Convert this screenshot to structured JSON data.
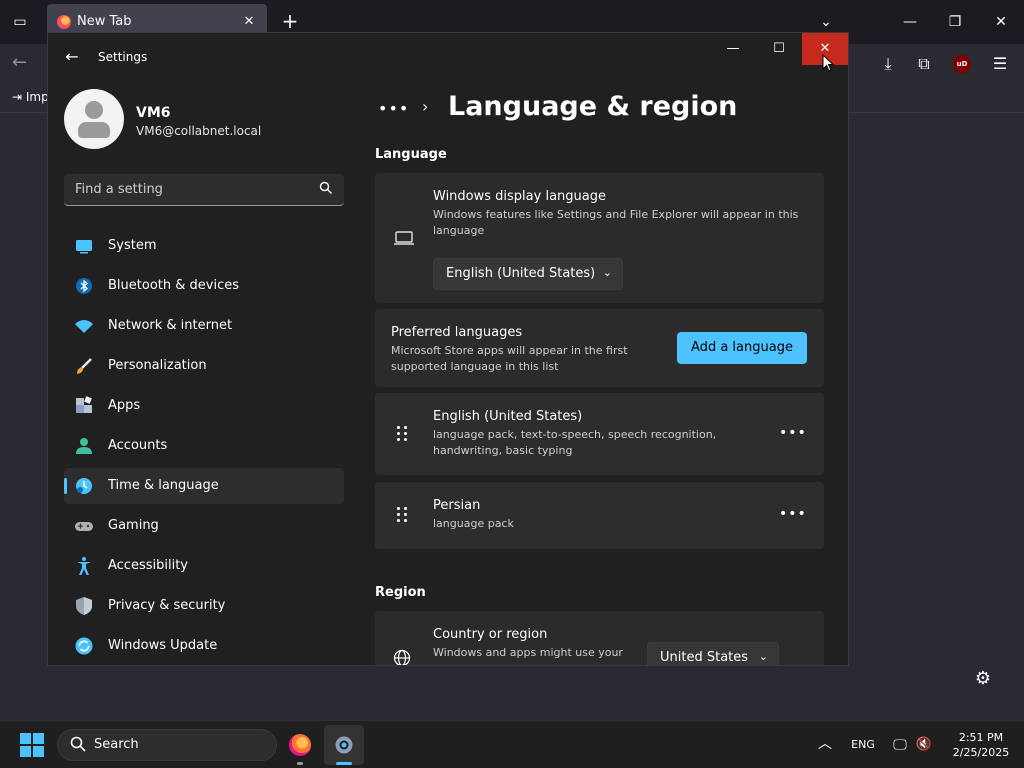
{
  "browser": {
    "tab_title": "New Tab",
    "tab_close": "✕",
    "new_tab": "+",
    "tabs_menu": "⌄",
    "minimize": "—",
    "restore": "❐",
    "close": "✕",
    "import_label": "Imp",
    "ublock_label": "uD"
  },
  "window": {
    "app_title": "Settings",
    "minimize": "—",
    "maximize": "☐",
    "close": "✕"
  },
  "profile": {
    "name": "VM6",
    "email": "VM6@collabnet.local"
  },
  "search": {
    "placeholder": "Find a setting"
  },
  "sidebar": {
    "items": [
      {
        "label": "System",
        "icon": "system-icon",
        "color": "#4cc2ff"
      },
      {
        "label": "Bluetooth & devices",
        "icon": "bluetooth-icon",
        "color": "#0f6cbd"
      },
      {
        "label": "Network & internet",
        "icon": "wifi-icon",
        "color": "#4cc2ff"
      },
      {
        "label": "Personalization",
        "icon": "brush-icon",
        "color": "#e8a33c"
      },
      {
        "label": "Apps",
        "icon": "apps-icon",
        "color": "#8ea2c0"
      },
      {
        "label": "Accounts",
        "icon": "accounts-icon",
        "color": "#3fc1a0"
      },
      {
        "label": "Time & language",
        "icon": "time-language-icon",
        "color": "#4cc2ff"
      },
      {
        "label": "Gaming",
        "icon": "gaming-icon",
        "color": "#b0b0b0"
      },
      {
        "label": "Accessibility",
        "icon": "accessibility-icon",
        "color": "#4cc2ff"
      },
      {
        "label": "Privacy & security",
        "icon": "shield-icon",
        "color": "#9aa4b0"
      },
      {
        "label": "Windows Update",
        "icon": "update-icon",
        "color": "#4cc2ff"
      }
    ],
    "selected_index": 6
  },
  "main": {
    "breadcrumb_more": "•••",
    "breadcrumb_sep": "›",
    "title": "Language & region",
    "language_section": "Language",
    "display_language": {
      "title": "Windows display language",
      "subtitle": "Windows features like Settings and File Explorer will appear in this language",
      "value": "English (United States)"
    },
    "preferred": {
      "title": "Preferred languages",
      "subtitle": "Microsoft Store apps will appear in the first supported language in this list",
      "add_button": "Add a language"
    },
    "languages": [
      {
        "name": "English (United States)",
        "features": "language pack, text-to-speech, speech recognition, handwriting, basic typing"
      },
      {
        "name": "Persian",
        "features": "language pack"
      }
    ],
    "more": "•••",
    "region_section": "Region",
    "country": {
      "title": "Country or region",
      "subtitle": "Windows and apps might use your",
      "value": "United States"
    }
  },
  "taskbar": {
    "search_label": "Search",
    "language": "ENG",
    "time": "2:51 PM",
    "date": "2/25/2025"
  },
  "accent_color": "#4cc2ff",
  "close_hover_color": "#c42b1c"
}
